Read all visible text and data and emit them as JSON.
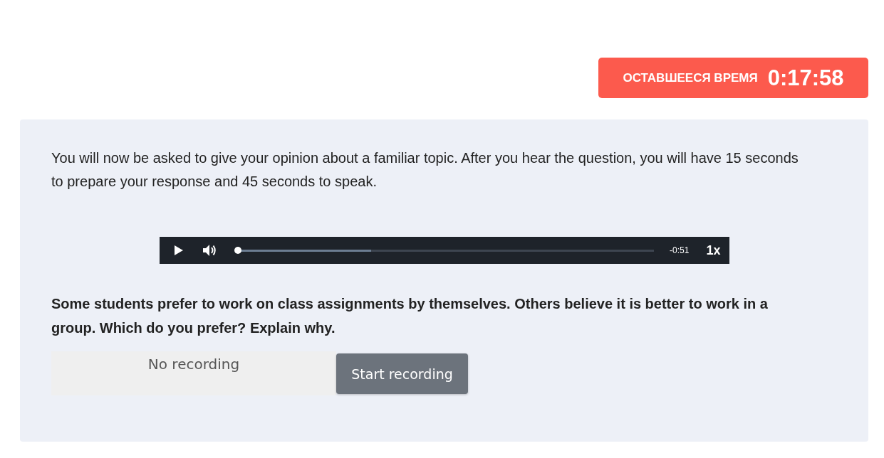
{
  "timer": {
    "label": "ОСТАВШЕЕСЯ ВРЕМЯ",
    "value": "0:17:58"
  },
  "instructions": "You will now be asked to give your opinion about a familiar topic. After you hear the question, you will have 15 seconds to prepare your response and 45 seconds to speak.",
  "audio_player": {
    "level": 0,
    "time": "-0:51",
    "speed": "1x"
  },
  "question": "Some students prefer to work on class assignments by themselves. Others believe it is better to work in a group. Which do you prefer? Explain why.",
  "recording": {
    "status": "No recording",
    "button": "Start recording"
  }
}
